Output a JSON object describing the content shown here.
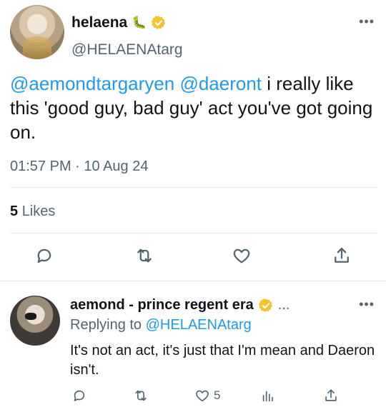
{
  "tweet": {
    "display_name": "helaena",
    "name_emoji": "🐛",
    "handle": "@HELAENAtarg",
    "more": "•••",
    "text_parts": {
      "mention1": "@aemondtargaryen",
      "space": " ",
      "mention2": "@daeront",
      "body": " i really like this 'good guy, bad guy' act you've got going on."
    },
    "timestamp": "01:57 PM · 10 Aug 24",
    "likes_count": "5",
    "likes_label": "Likes",
    "actions": [
      "reply-icon",
      "retweet-icon",
      "like-icon",
      "share-icon"
    ]
  },
  "reply": {
    "display_name": "aemond - prince regent era",
    "ellipsis": "...",
    "more": "•••",
    "replying_label": "Replying to",
    "replying_handle": "@HELAENAtarg",
    "text": "It's not an act, it's just that I'm mean and Daeron isn't.",
    "like_count": "5",
    "actions": [
      "reply-icon",
      "retweet-icon",
      "like-icon",
      "views-icon",
      "share-icon"
    ]
  },
  "colors": {
    "accent": "#1d9bf0",
    "secondary_text": "#536471",
    "verified_gold": "#f4c430",
    "divider": "#e6ecf0"
  }
}
